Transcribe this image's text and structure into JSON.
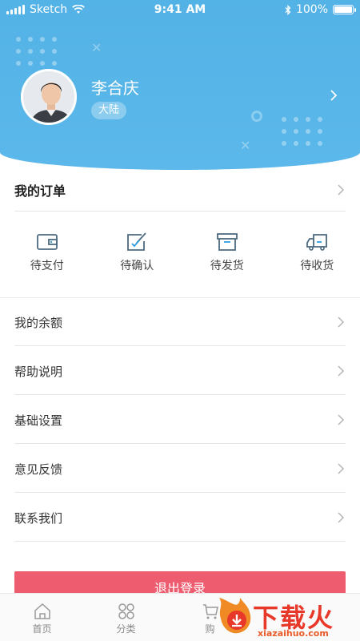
{
  "status_bar": {
    "carrier": "Sketch",
    "time": "9:41 AM",
    "battery": "100%",
    "battery_level": 1.0
  },
  "profile": {
    "name": "李合庆",
    "region": "大陆"
  },
  "orders": {
    "title": "我的订单",
    "items": [
      {
        "label": "待支付",
        "icon": "wallet-icon"
      },
      {
        "label": "待确认",
        "icon": "edit-check-icon"
      },
      {
        "label": "待发货",
        "icon": "box-icon"
      },
      {
        "label": "待收货",
        "icon": "truck-icon"
      }
    ]
  },
  "menu": [
    {
      "label": "我的余额"
    },
    {
      "label": "帮助说明"
    },
    {
      "label": "基础设置"
    },
    {
      "label": "意见反馈"
    },
    {
      "label": "联系我们"
    }
  ],
  "logout_label": "退出登录",
  "tabbar": [
    {
      "label": "首页",
      "icon": "home-icon"
    },
    {
      "label": "分类",
      "icon": "grid-icon"
    },
    {
      "label": "购",
      "icon": "cart-icon"
    }
  ],
  "watermark": {
    "text": "下载火",
    "domain": "xiazaihuo.com"
  },
  "colors": {
    "header": "#53b2e6",
    "logout": "#ee5d6f",
    "icon": "#4d6a80",
    "watermark": "#e8382a"
  }
}
